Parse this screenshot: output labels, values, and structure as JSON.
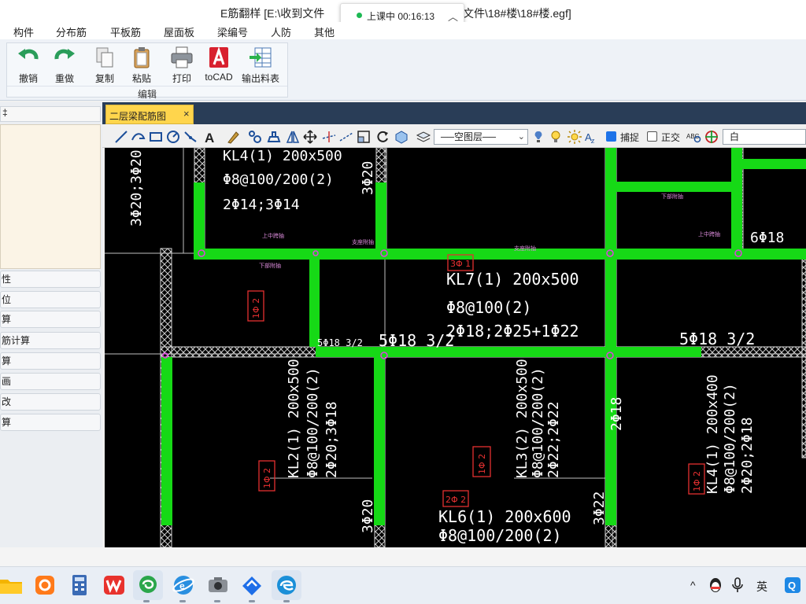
{
  "window": {
    "title_left": "E筋翻样    [E:\\收到文件",
    "title_right": "文件\\18#楼\\18#楼.egf]"
  },
  "class_indicator": {
    "label": "上课中 00:16:13",
    "dot_color": "#1db954"
  },
  "menu": {
    "items": [
      "构件",
      "分布筋",
      "平板筋",
      "屋面板",
      "梁编号",
      "人防",
      "其他"
    ]
  },
  "ribbon": {
    "group_label": "编辑",
    "buttons": [
      {
        "label": "撤销",
        "icon": "undo-icon"
      },
      {
        "label": "重做",
        "icon": "redo-icon"
      },
      {
        "label": "复制",
        "icon": "copy-icon"
      },
      {
        "label": "粘贴",
        "icon": "paste-icon"
      },
      {
        "label": "打印",
        "icon": "print-icon"
      },
      {
        "label": "toCAD",
        "icon": "autocad-icon"
      },
      {
        "label": "输出料表",
        "icon": "export-table-icon"
      }
    ]
  },
  "left_panel": {
    "top_label": "‡",
    "buttons": [
      "性",
      "位",
      "算",
      "筋计算",
      "算",
      "画",
      "改",
      "算"
    ]
  },
  "document_tab": {
    "label": "二层梁配筋图",
    "close": "×"
  },
  "draw_toolbar": {
    "layer_value": "──空图层──",
    "snap_label": "捕捉",
    "snap_checked": true,
    "ortho_label": "正交",
    "ortho_checked": false,
    "color_value": "白"
  },
  "drawing": {
    "beam_color": "#16d916",
    "labels": [
      {
        "text": "KL4(1) 200x500",
        "color": "#ffffff"
      },
      {
        "text": "Φ8@100/200(2)",
        "color": "#ffffff"
      },
      {
        "text": "2Φ14;3Φ14",
        "color": "#ffffff"
      },
      {
        "text": "3Φ20",
        "color": "#ffffff"
      },
      {
        "text": "3Φ20;3Φ20",
        "color": "#ffffff"
      },
      {
        "text": "KL7(1) 200x500",
        "color": "#ffffff"
      },
      {
        "text": "Φ8@100(2)",
        "color": "#ffffff"
      },
      {
        "text": "2Φ18;2Φ25+1Φ22",
        "color": "#ffffff"
      },
      {
        "text": "5Φ18 3/2",
        "color": "#ffffff"
      },
      {
        "text": "5Φ18 3/2",
        "color": "#ffffff"
      },
      {
        "text": "KL2(1) 200x500",
        "color": "#ffffff"
      },
      {
        "text": "Φ8@100/200(2)",
        "color": "#ffffff"
      },
      {
        "text": "2Φ20;3Φ18",
        "color": "#ffffff"
      },
      {
        "text": "KL3(2) 200x500",
        "color": "#ffffff"
      },
      {
        "text": "Φ8@100/200(2)",
        "color": "#ffffff"
      },
      {
        "text": "2Φ22;2Φ22",
        "color": "#ffffff"
      },
      {
        "text": "KL4(1) 200x400",
        "color": "#ffffff"
      },
      {
        "text": "Φ8@100/200(2)",
        "color": "#ffffff"
      },
      {
        "text": "2Φ20;2Φ18",
        "color": "#ffffff"
      },
      {
        "text": "KL6(1) 200x600",
        "color": "#ffffff"
      },
      {
        "text": "Φ8@100/200(2)",
        "color": "#ffffff"
      },
      {
        "text": "3Φ20",
        "color": "#ffffff"
      },
      {
        "text": "3Φ22",
        "color": "#ffffff"
      },
      {
        "text": "2Φ18",
        "color": "#ffffff"
      },
      {
        "text": "6Φ18",
        "color": "#ffffff"
      },
      {
        "text": "5Φ18 3/2",
        "color": "#ffffff"
      }
    ],
    "tags": [
      "3Φ 1",
      "1Φ 2",
      "1Φ 2",
      "1Φ 2",
      "2Φ 2",
      "1Φ 2"
    ]
  },
  "taskbar": {
    "apps": [
      "file-explorer-icon",
      "settings-icon",
      "calculator-icon",
      "wps-icon",
      "efanyang-icon",
      "browser-icon",
      "camera-app-icon",
      "feishu-icon",
      "edge-icon"
    ],
    "tray": {
      "chevron": "^",
      "ime": "英"
    }
  }
}
